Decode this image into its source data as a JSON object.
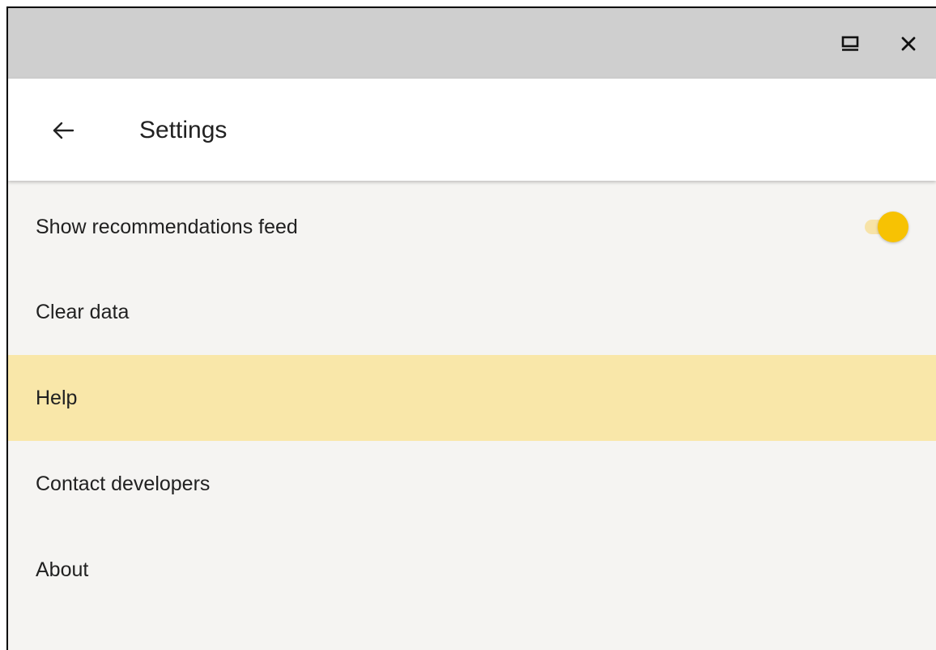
{
  "window": {
    "restore_icon": "restore-window-icon",
    "close_icon": "close-icon"
  },
  "appbar": {
    "back_icon": "arrow-back-icon",
    "title": "Settings"
  },
  "settings": {
    "items": [
      {
        "label": "Show recommendations feed",
        "toggle": true,
        "checked": true
      },
      {
        "label": "Clear data"
      },
      {
        "label": "Help",
        "highlighted": true
      },
      {
        "label": "Contact developers"
      },
      {
        "label": "About"
      }
    ]
  },
  "colors": {
    "titlebar": "#cfcfcf",
    "background": "#f5f4f2",
    "highlight": "#f9e7a9",
    "toggle_thumb": "#f7c203",
    "toggle_track": "#f7e3a8"
  }
}
